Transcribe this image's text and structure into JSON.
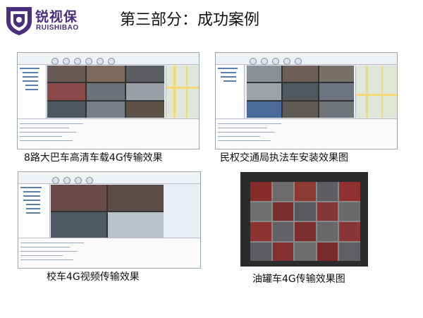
{
  "logo": {
    "cn": "锐视保",
    "en": "RUISHIBAO",
    "color": "#4b2f7f"
  },
  "slide": {
    "title": "第三部分：成功案例"
  },
  "cases": [
    {
      "caption": "8路大巴车高清车载4G传输效果",
      "icon": "vehicle-monitor-screenshot"
    },
    {
      "caption": "民权交通局执法车安装效果图",
      "icon": "vehicle-monitor-screenshot"
    },
    {
      "caption": "校车4G视频传输效果",
      "icon": "vehicle-monitor-screenshot"
    },
    {
      "caption": "油罐车4G传输效果图",
      "icon": "video-wall-photo"
    }
  ]
}
